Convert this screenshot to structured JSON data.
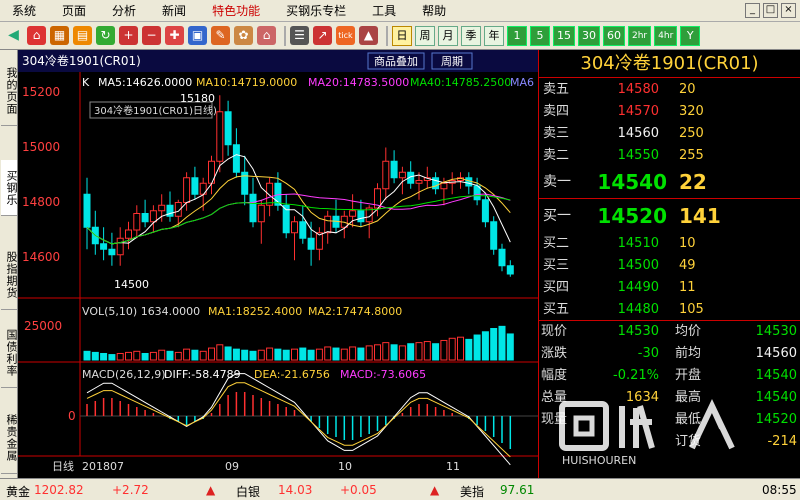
{
  "menu": [
    "系统",
    "页面",
    "分析",
    "新闻",
    "特色功能",
    "买钢乐专栏",
    "工具",
    "帮助"
  ],
  "menu_highlight": 4,
  "window_controls": [
    "_",
    "□",
    "×"
  ],
  "toolbar": {
    "periods": [
      "日",
      "周",
      "月",
      "季",
      "年",
      "1",
      "5",
      "15",
      "30",
      "60",
      "2hr",
      "4hr",
      "Y"
    ],
    "selected_period": 0
  },
  "sidebar_tabs": [
    "我的页面",
    "买钢乐",
    "股指期货",
    "国债利率",
    "稀贵金属"
  ],
  "chart": {
    "instrument": "304冷卷1901(CR01)",
    "mode_buttons": [
      "商品叠加",
      "周期"
    ],
    "ma_label": "K",
    "ma": [
      {
        "name": "MA5",
        "value": "14626.0000",
        "color": "#ffffff"
      },
      {
        "name": "MA10",
        "value": "14719.0000",
        "color": "#ffd23a"
      },
      {
        "name": "MA20",
        "value": "14783.5000",
        "color": "#ff3cff"
      },
      {
        "name": "MA40",
        "value": "14785.2500",
        "color": "#00e000"
      },
      {
        "name": "MA6",
        "value": "",
        "color": "#8888ff"
      }
    ],
    "legend_box": "304冷卷1901(CR01)日线)",
    "price_ticks": [
      "15200",
      "15000",
      "14800",
      "14600"
    ],
    "high_label": "15180",
    "low_label": "14500",
    "vol_label": "VOL(5,10) 1634.0000",
    "vol_ma1": "MA1:18252.4000",
    "vol_ma2": "MA2:17474.8000",
    "vol_tick": "25000",
    "macd_label": "MACD(26,12,9)",
    "macd_diff": "DIFF:-58.4789",
    "macd_dea": "DEA:-21.6756",
    "macd_val": "MACD:-73.6065",
    "macd_tick": "0",
    "xaxis": {
      "period": "日线",
      "start": "201807",
      "ticks": [
        "09",
        "10",
        "11"
      ]
    }
  },
  "chart_data": {
    "type": "candlestick",
    "title": "304冷卷1901(CR01)",
    "ylabel": "",
    "ylim": [
      14450,
      15250
    ],
    "candles": [
      [
        14820,
        14880,
        14620,
        14700
      ],
      [
        14700,
        14760,
        14600,
        14640
      ],
      [
        14640,
        14700,
        14580,
        14620
      ],
      [
        14620,
        14680,
        14560,
        14600
      ],
      [
        14600,
        14700,
        14560,
        14660
      ],
      [
        14660,
        14720,
        14620,
        14690
      ],
      [
        14690,
        14780,
        14660,
        14750
      ],
      [
        14750,
        14800,
        14700,
        14720
      ],
      [
        14720,
        14780,
        14680,
        14760
      ],
      [
        14760,
        14820,
        14720,
        14780
      ],
      [
        14780,
        14830,
        14720,
        14740
      ],
      [
        14740,
        14800,
        14700,
        14790
      ],
      [
        14790,
        14900,
        14760,
        14880
      ],
      [
        14880,
        14920,
        14800,
        14820
      ],
      [
        14820,
        14880,
        14760,
        14860
      ],
      [
        14860,
        14960,
        14820,
        14940
      ],
      [
        14940,
        15180,
        14900,
        15120
      ],
      [
        15120,
        15160,
        14960,
        15000
      ],
      [
        15000,
        15060,
        14880,
        14900
      ],
      [
        14900,
        14960,
        14780,
        14820
      ],
      [
        14820,
        14880,
        14700,
        14720
      ],
      [
        14720,
        14800,
        14640,
        14780
      ],
      [
        14780,
        14880,
        14740,
        14860
      ],
      [
        14860,
        14900,
        14760,
        14780
      ],
      [
        14780,
        14820,
        14660,
        14680
      ],
      [
        14680,
        14740,
        14580,
        14720
      ],
      [
        14720,
        14780,
        14640,
        14660
      ],
      [
        14660,
        14720,
        14560,
        14620
      ],
      [
        14620,
        14700,
        14580,
        14680
      ],
      [
        14680,
        14760,
        14640,
        14740
      ],
      [
        14740,
        14800,
        14680,
        14700
      ],
      [
        14700,
        14760,
        14660,
        14740
      ],
      [
        14740,
        14820,
        14700,
        14760
      ],
      [
        14760,
        14800,
        14700,
        14720
      ],
      [
        14720,
        14780,
        14660,
        14770
      ],
      [
        14770,
        14860,
        14740,
        14840
      ],
      [
        14840,
        14990,
        14800,
        14940
      ],
      [
        14940,
        14980,
        14860,
        14880
      ],
      [
        14880,
        14920,
        14820,
        14900
      ],
      [
        14900,
        14940,
        14840,
        14860
      ],
      [
        14860,
        14900,
        14800,
        14870
      ],
      [
        14870,
        14920,
        14840,
        14880
      ],
      [
        14880,
        14900,
        14820,
        14840
      ],
      [
        14840,
        14880,
        14780,
        14860
      ],
      [
        14860,
        14900,
        14820,
        14870
      ],
      [
        14870,
        14900,
        14840,
        14880
      ],
      [
        14880,
        14900,
        14820,
        14850
      ],
      [
        14850,
        14880,
        14780,
        14800
      ],
      [
        14800,
        14820,
        14700,
        14720
      ],
      [
        14720,
        14740,
        14600,
        14620
      ],
      [
        14620,
        14640,
        14540,
        14560
      ],
      [
        14560,
        14580,
        14520,
        14530
      ]
    ],
    "volume": [
      8,
      7,
      6,
      5,
      6,
      7,
      8,
      6,
      7,
      9,
      8,
      7,
      10,
      9,
      8,
      11,
      14,
      12,
      10,
      9,
      8,
      9,
      11,
      10,
      9,
      10,
      11,
      9,
      10,
      12,
      11,
      10,
      12,
      11,
      13,
      14,
      16,
      14,
      13,
      15,
      16,
      17,
      15,
      18,
      20,
      21,
      19,
      23,
      26,
      29,
      31,
      24
    ],
    "volume_max": 35,
    "macd": [
      4,
      5,
      6,
      6,
      5,
      4,
      3,
      2,
      1,
      0,
      -1,
      -2,
      -3,
      -2,
      -1,
      1,
      4,
      7,
      8,
      8,
      7,
      6,
      5,
      4,
      3,
      2,
      0,
      -2,
      -4,
      -6,
      -7,
      -8,
      -8,
      -7,
      -6,
      -5,
      -3,
      -1,
      1,
      3,
      4,
      4,
      3,
      2,
      1,
      0,
      -1,
      -3,
      -5,
      -7,
      -9,
      -11
    ],
    "macd_max": 12
  },
  "orderbook": {
    "asks": [
      {
        "label": "卖五",
        "price": "14580",
        "vol": "20"
      },
      {
        "label": "卖四",
        "price": "14570",
        "vol": "320"
      },
      {
        "label": "卖三",
        "price": "14560",
        "vol": "250"
      },
      {
        "label": "卖二",
        "price": "14550",
        "vol": "255"
      },
      {
        "label": "卖一",
        "price": "14540",
        "vol": "22"
      }
    ],
    "bids": [
      {
        "label": "买一",
        "price": "14520",
        "vol": "141"
      },
      {
        "label": "买二",
        "price": "14510",
        "vol": "10"
      },
      {
        "label": "买三",
        "price": "14500",
        "vol": "49"
      },
      {
        "label": "买四",
        "price": "14490",
        "vol": "11"
      },
      {
        "label": "买五",
        "price": "14480",
        "vol": "105"
      }
    ]
  },
  "stats": [
    {
      "l1": "现价",
      "v1": "14530",
      "c1": "green",
      "l2": "均价",
      "v2": "14530",
      "c2": "green"
    },
    {
      "l1": "涨跌",
      "v1": "-30",
      "c1": "green",
      "l2": "前均",
      "v2": "14560",
      "c2": "white"
    },
    {
      "l1": "幅度",
      "v1": "-0.21%",
      "c1": "green",
      "l2": "开盘",
      "v2": "14540",
      "c2": "green"
    },
    {
      "l1": "总量",
      "v1": "1634",
      "c1": "yellow",
      "l2": "最高",
      "v2": "14540",
      "c2": "green"
    },
    {
      "l1": "现量",
      "v1": "",
      "c1": "yellow",
      "l2": "最低",
      "v2": "14520",
      "c2": "green"
    },
    {
      "l1": "",
      "v1": "",
      "c1": "yellow",
      "l2": "订货",
      "v2": "-214",
      "c2": "yellow"
    }
  ],
  "statusbar": {
    "gold_label": "黄金",
    "gold_price": "1202.82",
    "gold_chg": "+2.72",
    "silver_label": "白银",
    "silver_price": "14.03",
    "silver_chg": "+0.05",
    "usd_label": "美指",
    "usd_price": "97.61",
    "time": "08:55"
  },
  "watermark": {
    "brand": "HUISHOUREN"
  }
}
